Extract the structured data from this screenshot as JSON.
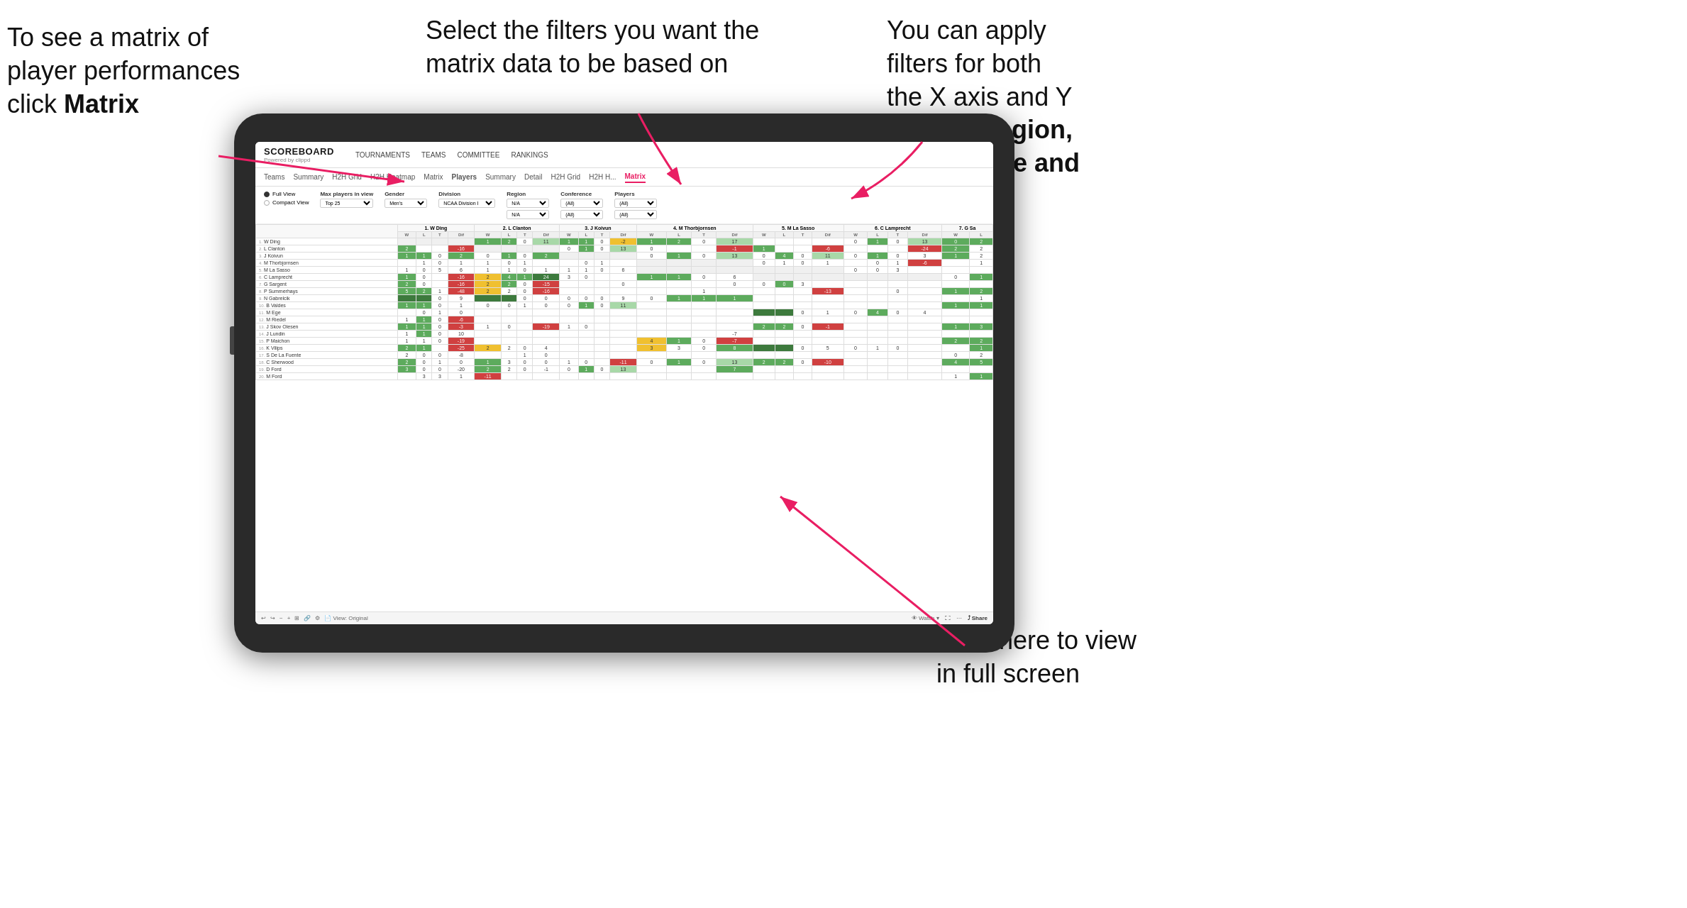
{
  "annotations": {
    "top_left": "To see a matrix of player performances click Matrix",
    "top_left_bold": "Matrix",
    "top_center": "Select the filters you want the matrix data to be based on",
    "top_right_line1": "You  can apply filters for both the X axis and Y Axis for ",
    "top_right_bold": "Region, Conference and Team",
    "bottom_right": "Click here to view in full screen"
  },
  "app": {
    "logo_main": "SCOREBOARD",
    "logo_sub": "Powered by clippd",
    "nav": [
      "TOURNAMENTS",
      "TEAMS",
      "COMMITTEE",
      "RANKINGS"
    ],
    "sub_nav": [
      "Teams",
      "Summary",
      "H2H Grid",
      "H2H Heatmap",
      "Matrix",
      "Players",
      "Summary",
      "Detail",
      "H2H Grid",
      "H2H H...",
      "Matrix"
    ],
    "active_tab": "Matrix"
  },
  "filters": {
    "view_options": [
      "Full View",
      "Compact View"
    ],
    "selected_view": "Full View",
    "max_players_label": "Max players in view",
    "max_players_value": "Top 25",
    "gender_label": "Gender",
    "gender_value": "Men's",
    "division_label": "Division",
    "division_value": "NCAA Division I",
    "region_label": "Region",
    "region_value": "N/A",
    "conference_label": "Conference",
    "conference_value": "(All)",
    "players_label": "Players",
    "players_value": "(All)"
  },
  "matrix": {
    "col_headers": [
      "1. W Ding",
      "2. L Clanton",
      "3. J Koivun",
      "4. M Thorbjornsen",
      "5. M La Sasso",
      "6. C Lamprecht",
      "7. G Sa"
    ],
    "sub_headers": [
      "W",
      "L",
      "T",
      "Dif"
    ],
    "rows": [
      {
        "num": "1.",
        "name": "W Ding"
      },
      {
        "num": "2.",
        "name": "L Clanton"
      },
      {
        "num": "3.",
        "name": "J Koivun"
      },
      {
        "num": "4.",
        "name": "M Thorbjornsen"
      },
      {
        "num": "5.",
        "name": "M La Sasso"
      },
      {
        "num": "6.",
        "name": "C Lamprecht"
      },
      {
        "num": "7.",
        "name": "G Sargent"
      },
      {
        "num": "8.",
        "name": "P Summerhays"
      },
      {
        "num": "9.",
        "name": "N Gabrelcik"
      },
      {
        "num": "10.",
        "name": "B Valdes"
      },
      {
        "num": "11.",
        "name": "M Ege"
      },
      {
        "num": "12.",
        "name": "M Riedel"
      },
      {
        "num": "13.",
        "name": "J Skov Olesen"
      },
      {
        "num": "14.",
        "name": "J Lundin"
      },
      {
        "num": "15.",
        "name": "P Maichon"
      },
      {
        "num": "16.",
        "name": "K Vilips"
      },
      {
        "num": "17.",
        "name": "S De La Fuente"
      },
      {
        "num": "18.",
        "name": "C Sherwood"
      },
      {
        "num": "19.",
        "name": "D Ford"
      },
      {
        "num": "20.",
        "name": "M Ford"
      }
    ]
  },
  "toolbar": {
    "view_label": "View: Original",
    "watch_label": "Watch",
    "share_label": "Share"
  }
}
